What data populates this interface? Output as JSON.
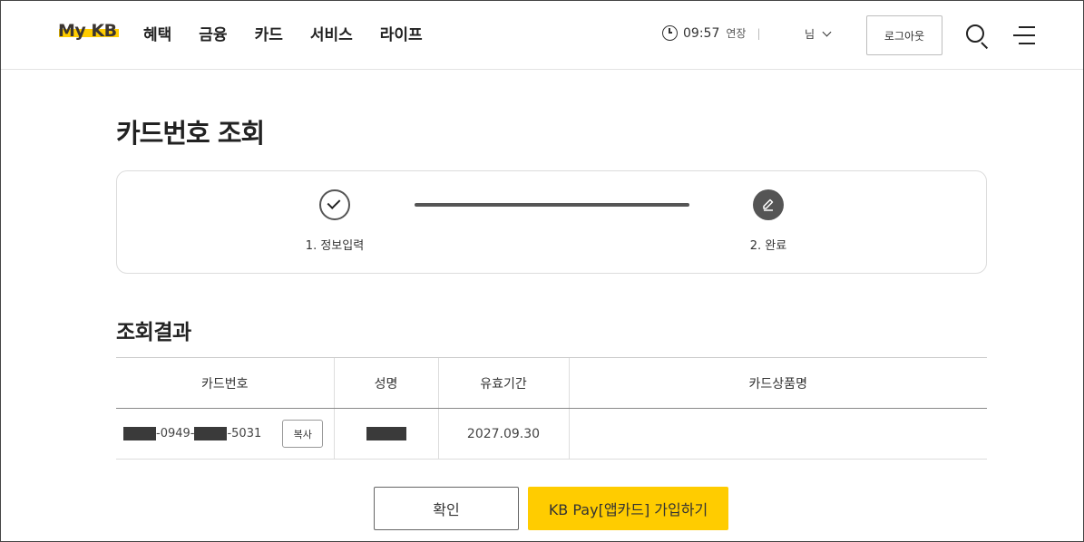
{
  "header": {
    "logo": "My KB",
    "nav": [
      "혜택",
      "금융",
      "카드",
      "서비스",
      "라이프"
    ],
    "session_time": "09:57",
    "extend_label": "연장",
    "user_suffix": "님",
    "logout_label": "로그아웃"
  },
  "page": {
    "title": "카드번호 조회",
    "steps": [
      {
        "label": "1. 정보입력",
        "status": "done"
      },
      {
        "label": "2. 완료",
        "status": "current"
      }
    ]
  },
  "result": {
    "title": "조회결과",
    "columns": [
      "카드번호",
      "성명",
      "유효기간",
      "카드상품명"
    ],
    "rows": [
      {
        "card_mid": "-0949-",
        "card_end": "-5031",
        "copy_label": "복사",
        "name": "",
        "expiry": "2027.09.30",
        "product": ""
      }
    ]
  },
  "actions": {
    "confirm_label": "확인",
    "kbpay_label": "KB Pay[앱카드] 가입하기"
  },
  "colors": {
    "accent": "#ffcc00",
    "step_dark": "#555555"
  },
  "icons": [
    "clock-icon",
    "chevron-down-icon",
    "search-icon",
    "menu-icon",
    "check-icon",
    "pencil-icon"
  ]
}
